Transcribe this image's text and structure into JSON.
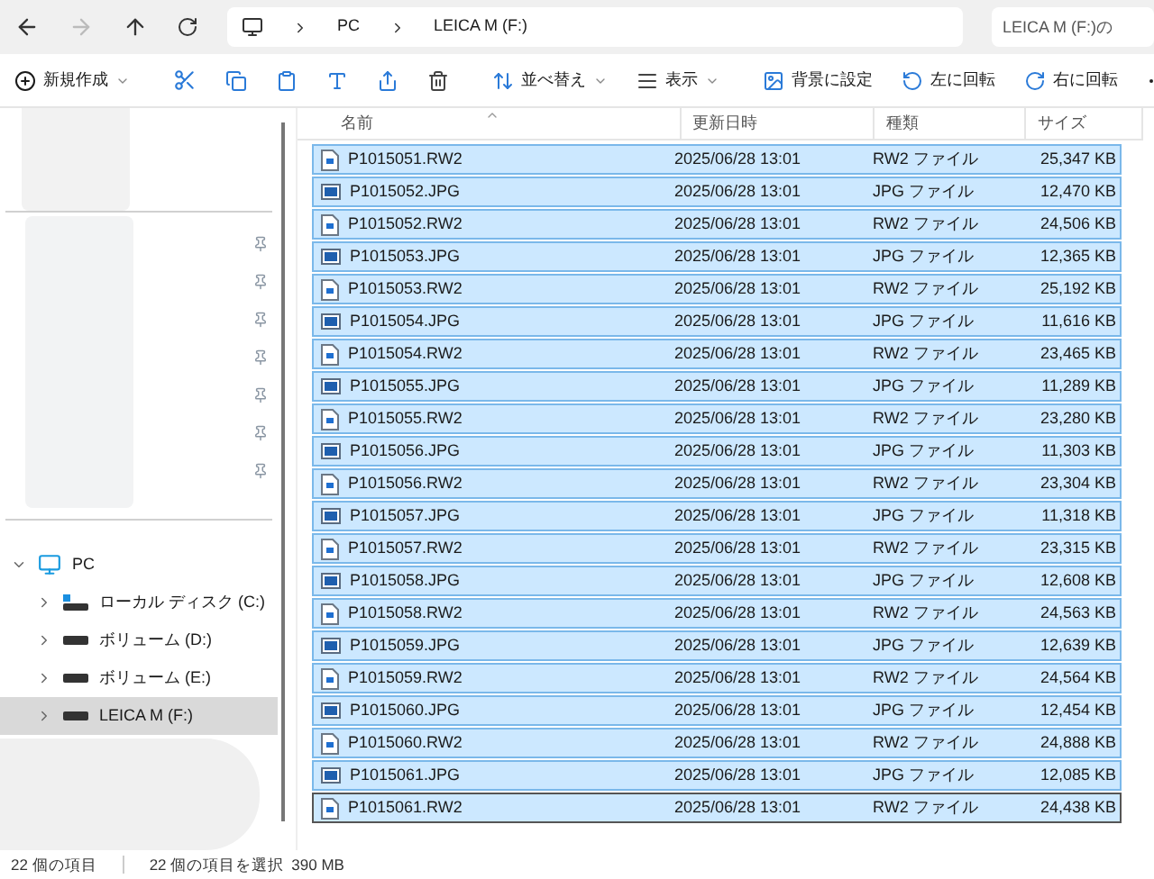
{
  "address_bar": {
    "segments": [
      "PC",
      "LEICA M (F:)"
    ],
    "search_placeholder": "LEICA M (F:)の"
  },
  "toolbar": {
    "new": "新規作成",
    "sort": "並べ替え",
    "view": "表示",
    "set_background": "背景に設定",
    "rotate_left": "左に回転",
    "rotate_right": "右に回転"
  },
  "sidebar": {
    "tree": [
      {
        "label": "PC",
        "kind": "pc",
        "expanded": true,
        "selected": false,
        "children": [
          {
            "label": "ローカル ディスク (C:)",
            "kind": "system",
            "expanded": false,
            "selected": false
          },
          {
            "label": "ボリューム (D:)",
            "kind": "drive",
            "expanded": false,
            "selected": false
          },
          {
            "label": "ボリューム (E:)",
            "kind": "drive",
            "expanded": false,
            "selected": false
          },
          {
            "label": "LEICA M (F:)",
            "kind": "drive",
            "expanded": false,
            "selected": true
          }
        ]
      }
    ]
  },
  "table": {
    "columns": [
      "名前",
      "更新日時",
      "種類",
      "サイズ"
    ],
    "rows": [
      {
        "name": "P1015051.RW2",
        "kind": "raw",
        "date": "2025/06/28 13:01",
        "type": "RW2 ファイル",
        "size": "25,347 KB",
        "selected": true,
        "focused": false
      },
      {
        "name": "P1015052.JPG",
        "kind": "image",
        "date": "2025/06/28 13:01",
        "type": "JPG ファイル",
        "size": "12,470 KB",
        "selected": true,
        "focused": false
      },
      {
        "name": "P1015052.RW2",
        "kind": "raw",
        "date": "2025/06/28 13:01",
        "type": "RW2 ファイル",
        "size": "24,506 KB",
        "selected": true,
        "focused": false
      },
      {
        "name": "P1015053.JPG",
        "kind": "image",
        "date": "2025/06/28 13:01",
        "type": "JPG ファイル",
        "size": "12,365 KB",
        "selected": true,
        "focused": false
      },
      {
        "name": "P1015053.RW2",
        "kind": "raw",
        "date": "2025/06/28 13:01",
        "type": "RW2 ファイル",
        "size": "25,192 KB",
        "selected": true,
        "focused": false
      },
      {
        "name": "P1015054.JPG",
        "kind": "image",
        "date": "2025/06/28 13:01",
        "type": "JPG ファイル",
        "size": "11,616 KB",
        "selected": true,
        "focused": false
      },
      {
        "name": "P1015054.RW2",
        "kind": "raw",
        "date": "2025/06/28 13:01",
        "type": "RW2 ファイル",
        "size": "23,465 KB",
        "selected": true,
        "focused": false
      },
      {
        "name": "P1015055.JPG",
        "kind": "image",
        "date": "2025/06/28 13:01",
        "type": "JPG ファイル",
        "size": "11,289 KB",
        "selected": true,
        "focused": false
      },
      {
        "name": "P1015055.RW2",
        "kind": "raw",
        "date": "2025/06/28 13:01",
        "type": "RW2 ファイル",
        "size": "23,280 KB",
        "selected": true,
        "focused": false
      },
      {
        "name": "P1015056.JPG",
        "kind": "image",
        "date": "2025/06/28 13:01",
        "type": "JPG ファイル",
        "size": "11,303 KB",
        "selected": true,
        "focused": false
      },
      {
        "name": "P1015056.RW2",
        "kind": "raw",
        "date": "2025/06/28 13:01",
        "type": "RW2 ファイル",
        "size": "23,304 KB",
        "selected": true,
        "focused": false
      },
      {
        "name": "P1015057.JPG",
        "kind": "image",
        "date": "2025/06/28 13:01",
        "type": "JPG ファイル",
        "size": "11,318 KB",
        "selected": true,
        "focused": false
      },
      {
        "name": "P1015057.RW2",
        "kind": "raw",
        "date": "2025/06/28 13:01",
        "type": "RW2 ファイル",
        "size": "23,315 KB",
        "selected": true,
        "focused": false
      },
      {
        "name": "P1015058.JPG",
        "kind": "image",
        "date": "2025/06/28 13:01",
        "type": "JPG ファイル",
        "size": "12,608 KB",
        "selected": true,
        "focused": false
      },
      {
        "name": "P1015058.RW2",
        "kind": "raw",
        "date": "2025/06/28 13:01",
        "type": "RW2 ファイル",
        "size": "24,563 KB",
        "selected": true,
        "focused": false
      },
      {
        "name": "P1015059.JPG",
        "kind": "image",
        "date": "2025/06/28 13:01",
        "type": "JPG ファイル",
        "size": "12,639 KB",
        "selected": true,
        "focused": false
      },
      {
        "name": "P1015059.RW2",
        "kind": "raw",
        "date": "2025/06/28 13:01",
        "type": "RW2 ファイル",
        "size": "24,564 KB",
        "selected": true,
        "focused": false
      },
      {
        "name": "P1015060.JPG",
        "kind": "image",
        "date": "2025/06/28 13:01",
        "type": "JPG ファイル",
        "size": "12,454 KB",
        "selected": true,
        "focused": false
      },
      {
        "name": "P1015060.RW2",
        "kind": "raw",
        "date": "2025/06/28 13:01",
        "type": "RW2 ファイル",
        "size": "24,888 KB",
        "selected": true,
        "focused": false
      },
      {
        "name": "P1015061.JPG",
        "kind": "image",
        "date": "2025/06/28 13:01",
        "type": "JPG ファイル",
        "size": "12,085 KB",
        "selected": true,
        "focused": false
      },
      {
        "name": "P1015061.RW2",
        "kind": "raw",
        "date": "2025/06/28 13:01",
        "type": "RW2 ファイル",
        "size": "24,438 KB",
        "selected": true,
        "focused": true
      }
    ]
  },
  "status_bar": {
    "count": "22 個の項目",
    "selection": "22 個の項目を選択",
    "size": "390 MB"
  }
}
